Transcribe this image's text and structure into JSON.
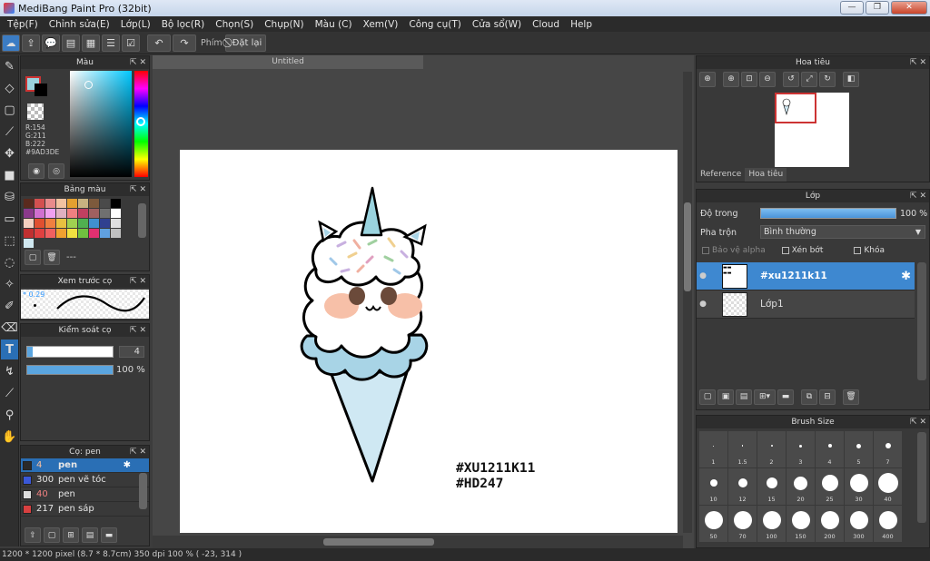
{
  "window": {
    "title": "MediBang Paint Pro (32bit)",
    "minimize": "—",
    "maximize": "❐",
    "close": "✕"
  },
  "menu": [
    "Tệp(F)",
    "Chỉnh sửa(E)",
    "Lớp(L)",
    "Bộ lọc(R)",
    "Chọn(S)",
    "Chụp(N)",
    "Màu (C)",
    "Xem(V)",
    "Công cụ(T)",
    "Cửa sổ(W)",
    "Cloud",
    "Help"
  ],
  "toolbar": {
    "key_label": "Phím",
    "reset_label": "Đặt lại"
  },
  "color_panel": {
    "title": "Màu",
    "r": "R:154",
    "g": "G:211",
    "b": "B:222",
    "hex": "#9AD3DE",
    "main_color": "#9ad3de"
  },
  "palette_panel": {
    "title": "Bảng màu",
    "footer": "---",
    "colors": [
      "#5a2a1e",
      "#d45050",
      "#e98c8c",
      "#f2c2a0",
      "#e3a030",
      "#c8b280",
      "#7d5a3c",
      "#4a4a4a",
      "#000000",
      "#8b3a8b",
      "#d070d0",
      "#f0a0f0",
      "#e0b0c0",
      "#f08080",
      "#c04060",
      "#a06060",
      "#707070",
      "#ffffff",
      "#f5d0c0",
      "#e05030",
      "#f08040",
      "#e8c040",
      "#a0d050",
      "#50b050",
      "#4090d0",
      "#304090",
      "#e0e0e0",
      "#c03030",
      "#e04040",
      "#f06060",
      "#f0a030",
      "#f0e040",
      "#70c040",
      "#e03070",
      "#60a0e0",
      "#c0c0c0",
      "#d0e8f0"
    ]
  },
  "brush_preview_panel": {
    "title": "Xem trước cọ",
    "size": "* 0.29"
  },
  "brush_control_panel": {
    "title": "Kiểm soát cọ",
    "size": "4",
    "opacity": "100 %"
  },
  "brush_panel": {
    "title": "Cọ: pen",
    "items": [
      {
        "size": "4",
        "name": "pen",
        "color": "#2a2a2a"
      },
      {
        "size": "300",
        "name": "pen vẽ tóc",
        "color": "#3a58d8"
      },
      {
        "size": "40",
        "name": "pen",
        "color": "#dddddd"
      },
      {
        "size": "217",
        "name": "pen sáp",
        "color": "#d84040"
      }
    ]
  },
  "canvas": {
    "tab": "Untitled",
    "sig_line1": "#XU1211K11",
    "sig_line2": "#HD247"
  },
  "navigator_panel": {
    "title": "Hoa tiêu",
    "tab_reference": "Reference",
    "tab_navigator": "Hoa tiêu"
  },
  "layer_panel": {
    "title": "Lớp",
    "opacity_label": "Độ trong",
    "opacity_value": "100 %",
    "blend_label": "Pha trộn",
    "blend_value": "Bình thường",
    "protect_alpha": "Bảo vệ alpha",
    "clipping": "Xén bớt",
    "lock": "Khóa",
    "layers": [
      {
        "name": "#xu1211k11"
      },
      {
        "name": "Lớp1"
      }
    ]
  },
  "brush_size_panel": {
    "title": "Brush Size",
    "sizes": [
      "1",
      "1.5",
      "2",
      "3",
      "4",
      "5",
      "7",
      "10",
      "12",
      "15",
      "20",
      "25",
      "30",
      "40",
      "50",
      "70",
      "100",
      "150",
      "200",
      "300",
      "400"
    ]
  },
  "status": {
    "text": "1200 * 1200 pixel   (8.7 * 8.7cm)   350 dpi   100 %   ( -23, 314 )"
  }
}
